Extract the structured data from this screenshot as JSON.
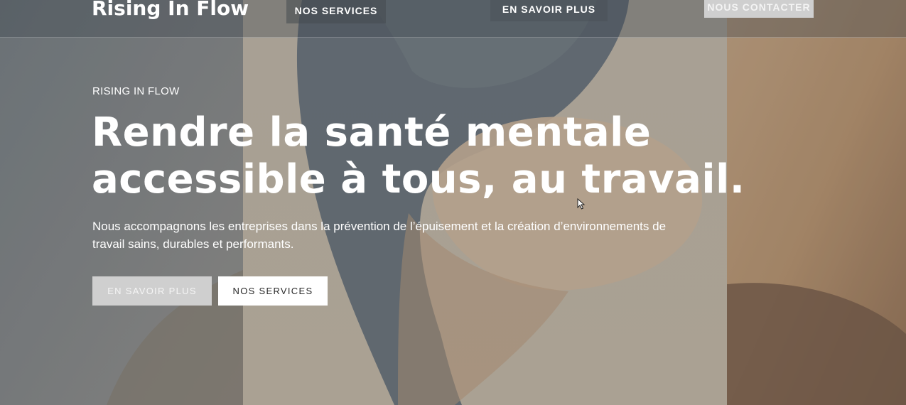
{
  "header": {
    "brand": "Rising In Flow",
    "nav": {
      "services": "NOS SERVICES",
      "savoir": "EN SAVOIR PLUS",
      "contact": "NOUS CONTACTER"
    }
  },
  "hero": {
    "eyebrow": "RISING IN FLOW",
    "headline_line1": "Rendre la santé mentale",
    "headline_line2": "accessible à tous, au travail.",
    "lead": "Nous accompagnons les entreprises dans la prévention de l’épuisement et la création d’environnements de travail sains, durables et performants.",
    "buttons": {
      "savoir": "EN SAVOIR PLUS",
      "services": "NOS SERVICES"
    }
  },
  "icons": {
    "cursor": "mouse-pointer-icon"
  }
}
